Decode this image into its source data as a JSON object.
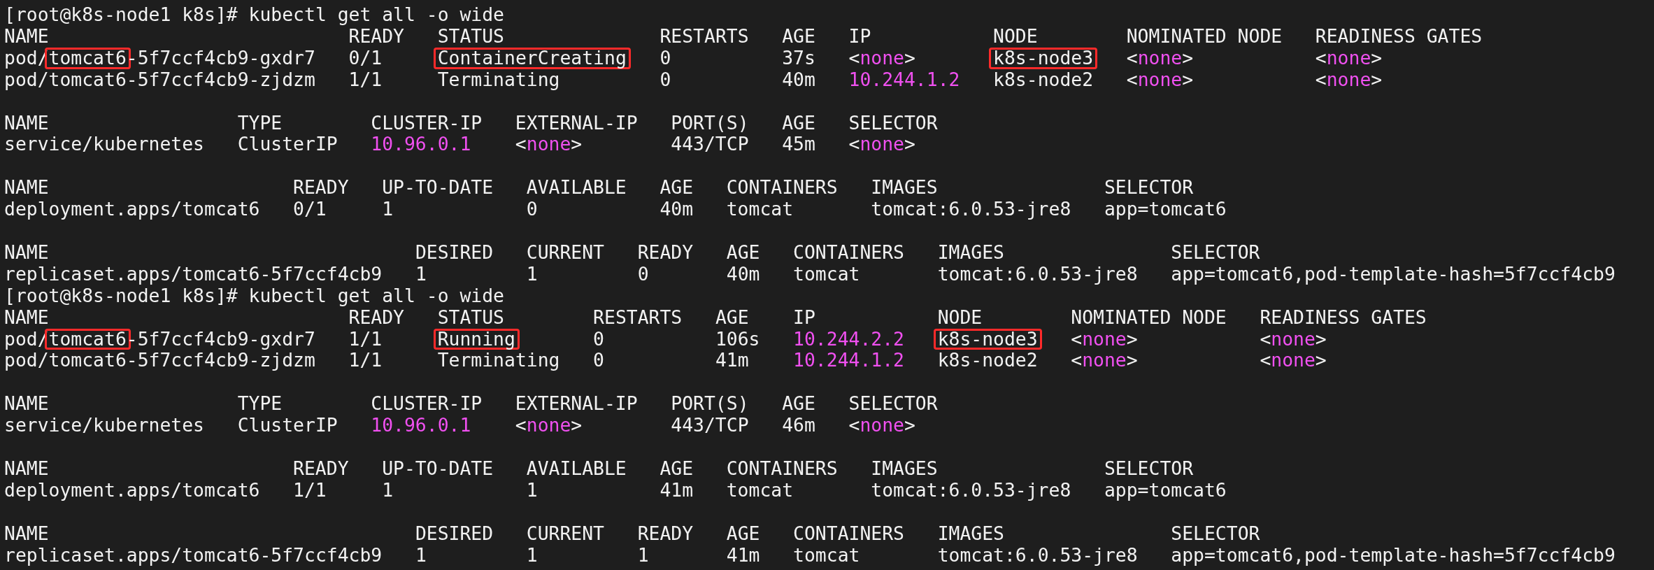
{
  "terminal": {
    "blocks": [
      {
        "kind": "prompt",
        "text": "[root@k8s-node1 k8s]# kubectl get all -o wide"
      },
      {
        "kind": "table",
        "columns": [
          "NAME",
          "READY",
          "STATUS",
          "RESTARTS",
          "AGE",
          "IP",
          "NODE",
          "NOMINATED NODE",
          "READINESS GATES"
        ],
        "rows": [
          [
            {
              "parts": [
                {
                  "text": "pod/",
                  "boxed": false
                },
                {
                  "text": "tomcat6",
                  "boxed": true
                },
                {
                  "text": "-5f7ccf4cb9-gxdr7",
                  "boxed": false
                }
              ]
            },
            {
              "text": "0/1"
            },
            {
              "text": "ContainerCreating",
              "boxed": true
            },
            {
              "text": "0"
            },
            {
              "text": "37s"
            },
            {
              "text": "<none>",
              "kind": "none"
            },
            {
              "text": "k8s-node3",
              "boxed": true
            },
            {
              "text": "<none>",
              "kind": "none"
            },
            {
              "text": "<none>",
              "kind": "none"
            }
          ],
          [
            {
              "text": "pod/tomcat6-5f7ccf4cb9-zjdzm"
            },
            {
              "text": "1/1"
            },
            {
              "text": "Terminating"
            },
            {
              "text": "0"
            },
            {
              "text": "40m"
            },
            {
              "text": "10.244.1.2",
              "kind": "address"
            },
            {
              "text": "k8s-node2"
            },
            {
              "text": "<none>",
              "kind": "none"
            },
            {
              "text": "<none>",
              "kind": "none"
            }
          ]
        ]
      },
      {
        "kind": "table",
        "columns": [
          "NAME",
          "TYPE",
          "CLUSTER-IP",
          "EXTERNAL-IP",
          "PORT(S)",
          "AGE",
          "SELECTOR"
        ],
        "rows": [
          [
            {
              "text": "service/kubernetes"
            },
            {
              "text": "ClusterIP"
            },
            {
              "text": "10.96.0.1",
              "kind": "address"
            },
            {
              "text": "<none>",
              "kind": "none"
            },
            {
              "text": "443/TCP"
            },
            {
              "text": "45m"
            },
            {
              "text": "<none>",
              "kind": "none"
            }
          ]
        ]
      },
      {
        "kind": "table",
        "columns": [
          "NAME",
          "READY",
          "UP-TO-DATE",
          "AVAILABLE",
          "AGE",
          "CONTAINERS",
          "IMAGES",
          "SELECTOR"
        ],
        "rows": [
          [
            {
              "text": "deployment.apps/tomcat6"
            },
            {
              "text": "0/1"
            },
            {
              "text": "1"
            },
            {
              "text": "0"
            },
            {
              "text": "40m"
            },
            {
              "text": "tomcat"
            },
            {
              "text": "tomcat:6.0.53-jre8"
            },
            {
              "text": "app=tomcat6"
            }
          ]
        ]
      },
      {
        "kind": "table",
        "columns": [
          "NAME",
          "DESIRED",
          "CURRENT",
          "READY",
          "AGE",
          "CONTAINERS",
          "IMAGES",
          "SELECTOR"
        ],
        "rows": [
          [
            {
              "text": "replicaset.apps/tomcat6-5f7ccf4cb9"
            },
            {
              "text": "1"
            },
            {
              "text": "1"
            },
            {
              "text": "0"
            },
            {
              "text": "40m"
            },
            {
              "text": "tomcat"
            },
            {
              "text": "tomcat:6.0.53-jre8"
            },
            {
              "text": "app=tomcat6,pod-template-hash=5f7ccf4cb9"
            }
          ]
        ]
      },
      {
        "kind": "prompt",
        "text": "[root@k8s-node1 k8s]# kubectl get all -o wide"
      },
      {
        "kind": "table",
        "columns": [
          "NAME",
          "READY",
          "STATUS",
          "RESTARTS",
          "AGE",
          "IP",
          "NODE",
          "NOMINATED NODE",
          "READINESS GATES"
        ],
        "rows": [
          [
            {
              "parts": [
                {
                  "text": "pod/",
                  "boxed": false
                },
                {
                  "text": "tomcat6",
                  "boxed": true
                },
                {
                  "text": "-5f7ccf4cb9-gxdr7",
                  "boxed": false
                }
              ]
            },
            {
              "text": "1/1"
            },
            {
              "text": "Running",
              "boxed": true
            },
            {
              "text": "0"
            },
            {
              "text": "106s"
            },
            {
              "text": "10.244.2.2",
              "kind": "address"
            },
            {
              "text": "k8s-node3",
              "boxed": true
            },
            {
              "text": "<none>",
              "kind": "none"
            },
            {
              "text": "<none>",
              "kind": "none"
            }
          ],
          [
            {
              "text": "pod/tomcat6-5f7ccf4cb9-zjdzm"
            },
            {
              "text": "1/1"
            },
            {
              "text": "Terminating"
            },
            {
              "text": "0"
            },
            {
              "text": "41m"
            },
            {
              "text": "10.244.1.2",
              "kind": "address"
            },
            {
              "text": "k8s-node2"
            },
            {
              "text": "<none>",
              "kind": "none"
            },
            {
              "text": "<none>",
              "kind": "none"
            }
          ]
        ]
      },
      {
        "kind": "table",
        "columns": [
          "NAME",
          "TYPE",
          "CLUSTER-IP",
          "EXTERNAL-IP",
          "PORT(S)",
          "AGE",
          "SELECTOR"
        ],
        "rows": [
          [
            {
              "text": "service/kubernetes"
            },
            {
              "text": "ClusterIP"
            },
            {
              "text": "10.96.0.1",
              "kind": "address"
            },
            {
              "text": "<none>",
              "kind": "none"
            },
            {
              "text": "443/TCP"
            },
            {
              "text": "46m"
            },
            {
              "text": "<none>",
              "kind": "none"
            }
          ]
        ]
      },
      {
        "kind": "table",
        "columns": [
          "NAME",
          "READY",
          "UP-TO-DATE",
          "AVAILABLE",
          "AGE",
          "CONTAINERS",
          "IMAGES",
          "SELECTOR"
        ],
        "rows": [
          [
            {
              "text": "deployment.apps/tomcat6"
            },
            {
              "text": "1/1"
            },
            {
              "text": "1"
            },
            {
              "text": "1"
            },
            {
              "text": "41m"
            },
            {
              "text": "tomcat"
            },
            {
              "text": "tomcat:6.0.53-jre8"
            },
            {
              "text": "app=tomcat6"
            }
          ]
        ]
      },
      {
        "kind": "table",
        "columns": [
          "NAME",
          "DESIRED",
          "CURRENT",
          "READY",
          "AGE",
          "CONTAINERS",
          "IMAGES",
          "SELECTOR"
        ],
        "rows": [
          [
            {
              "text": "replicaset.apps/tomcat6-5f7ccf4cb9"
            },
            {
              "text": "1"
            },
            {
              "text": "1"
            },
            {
              "text": "1"
            },
            {
              "text": "41m"
            },
            {
              "text": "tomcat"
            },
            {
              "text": "tomcat:6.0.53-jre8"
            },
            {
              "text": "app=tomcat6,pod-template-hash=5f7ccf4cb9"
            }
          ]
        ]
      }
    ]
  }
}
